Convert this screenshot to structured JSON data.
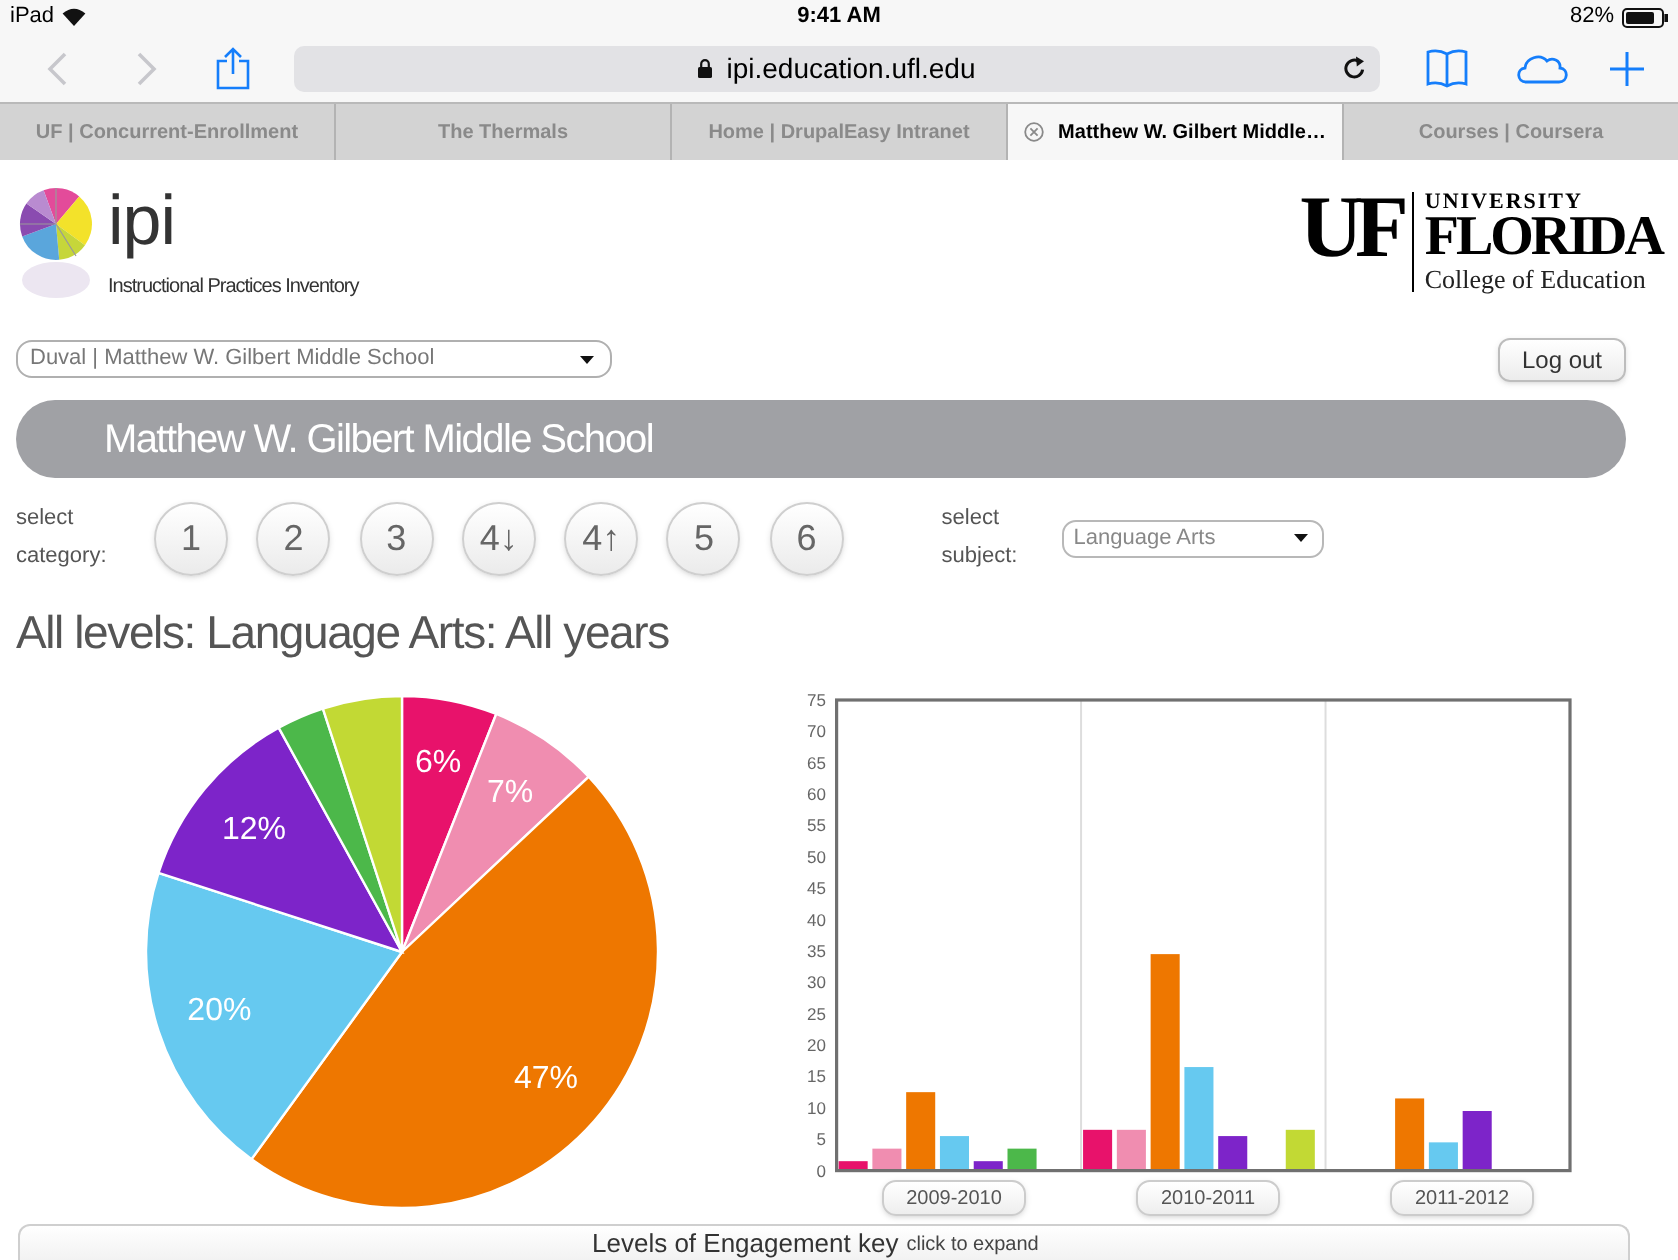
{
  "status_bar": {
    "device": "iPad",
    "time": "9:41 AM",
    "battery": "82%"
  },
  "browser": {
    "back": {
      "disabled": true
    },
    "forward": {
      "disabled": true
    },
    "url": "ipi.education.ufl.edu",
    "tabs": [
      {
        "label": "UF | Concurrent-Enrollment",
        "selected": false
      },
      {
        "label": "The Thermals",
        "selected": false
      },
      {
        "label": "Home | DrupalEasy Intranet",
        "selected": false
      },
      {
        "label": "Matthew W. Gilbert Middle…",
        "selected": true
      },
      {
        "label": "Courses | Coursera",
        "selected": false
      }
    ]
  },
  "header": {
    "logo": "ipi",
    "tagline": "Instructional Practices Inventory",
    "university_logo": {
      "mark": "UF",
      "line_1": "UNIVERSITY",
      "line_2": "FLORIDA",
      "line_3": "College of Education"
    }
  },
  "school_select": {
    "value": "Duval | Matthew W. Gilbert Middle School"
  },
  "logout_button": {
    "label": "Log out"
  },
  "banner": {
    "title": "Matthew W. Gilbert Middle School"
  },
  "category": {
    "label": "select category:",
    "buttons": [
      "1",
      "2",
      "3",
      "4↓",
      "4↑",
      "5",
      "6"
    ]
  },
  "subject": {
    "label": "select subject:",
    "value": "Language Arts"
  },
  "heading": "All levels: Language Arts: All years",
  "pie": {
    "chart_data": {
      "type": "pie",
      "values": [
        6,
        7,
        47,
        20,
        12,
        3,
        5
      ],
      "colors": [
        "#e8126b",
        "#f08db0",
        "#ee7700",
        "#66c9f0",
        "#7d24c9",
        "#4cb84a",
        "#c2d934"
      ],
      "value_labels": [
        "6%",
        "7%",
        "47%",
        "20%",
        "12%",
        null,
        null
      ]
    }
  },
  "bar": {
    "chart_data": {
      "type": "bar",
      "categories": [
        "2009-2010",
        "2010-2011",
        "2011-2012"
      ],
      "ylim": [
        0,
        75
      ],
      "yticks": [
        0,
        5,
        10,
        15,
        20,
        25,
        30,
        35,
        40,
        45,
        50,
        55,
        60,
        65,
        70,
        75
      ],
      "series": [
        {
          "color": "#e8126b",
          "values": [
            1.5,
            6.5,
            0
          ]
        },
        {
          "color": "#f08db0",
          "values": [
            3.5,
            6.5,
            0
          ]
        },
        {
          "color": "#ee7700",
          "values": [
            12.5,
            34.5,
            11.5
          ]
        },
        {
          "color": "#66c9f0",
          "values": [
            5.5,
            16.5,
            4.5
          ]
        },
        {
          "color": "#7d24c9",
          "values": [
            1.5,
            5.5,
            9.5
          ]
        },
        {
          "color": "#4cb84a",
          "values": [
            3.5,
            0,
            0
          ]
        },
        {
          "color": "#c2d934",
          "values": [
            0,
            6.5,
            0
          ]
        }
      ]
    }
  },
  "engagement_key": {
    "title": "Levels of Engagement key",
    "hint": "click to expand"
  }
}
